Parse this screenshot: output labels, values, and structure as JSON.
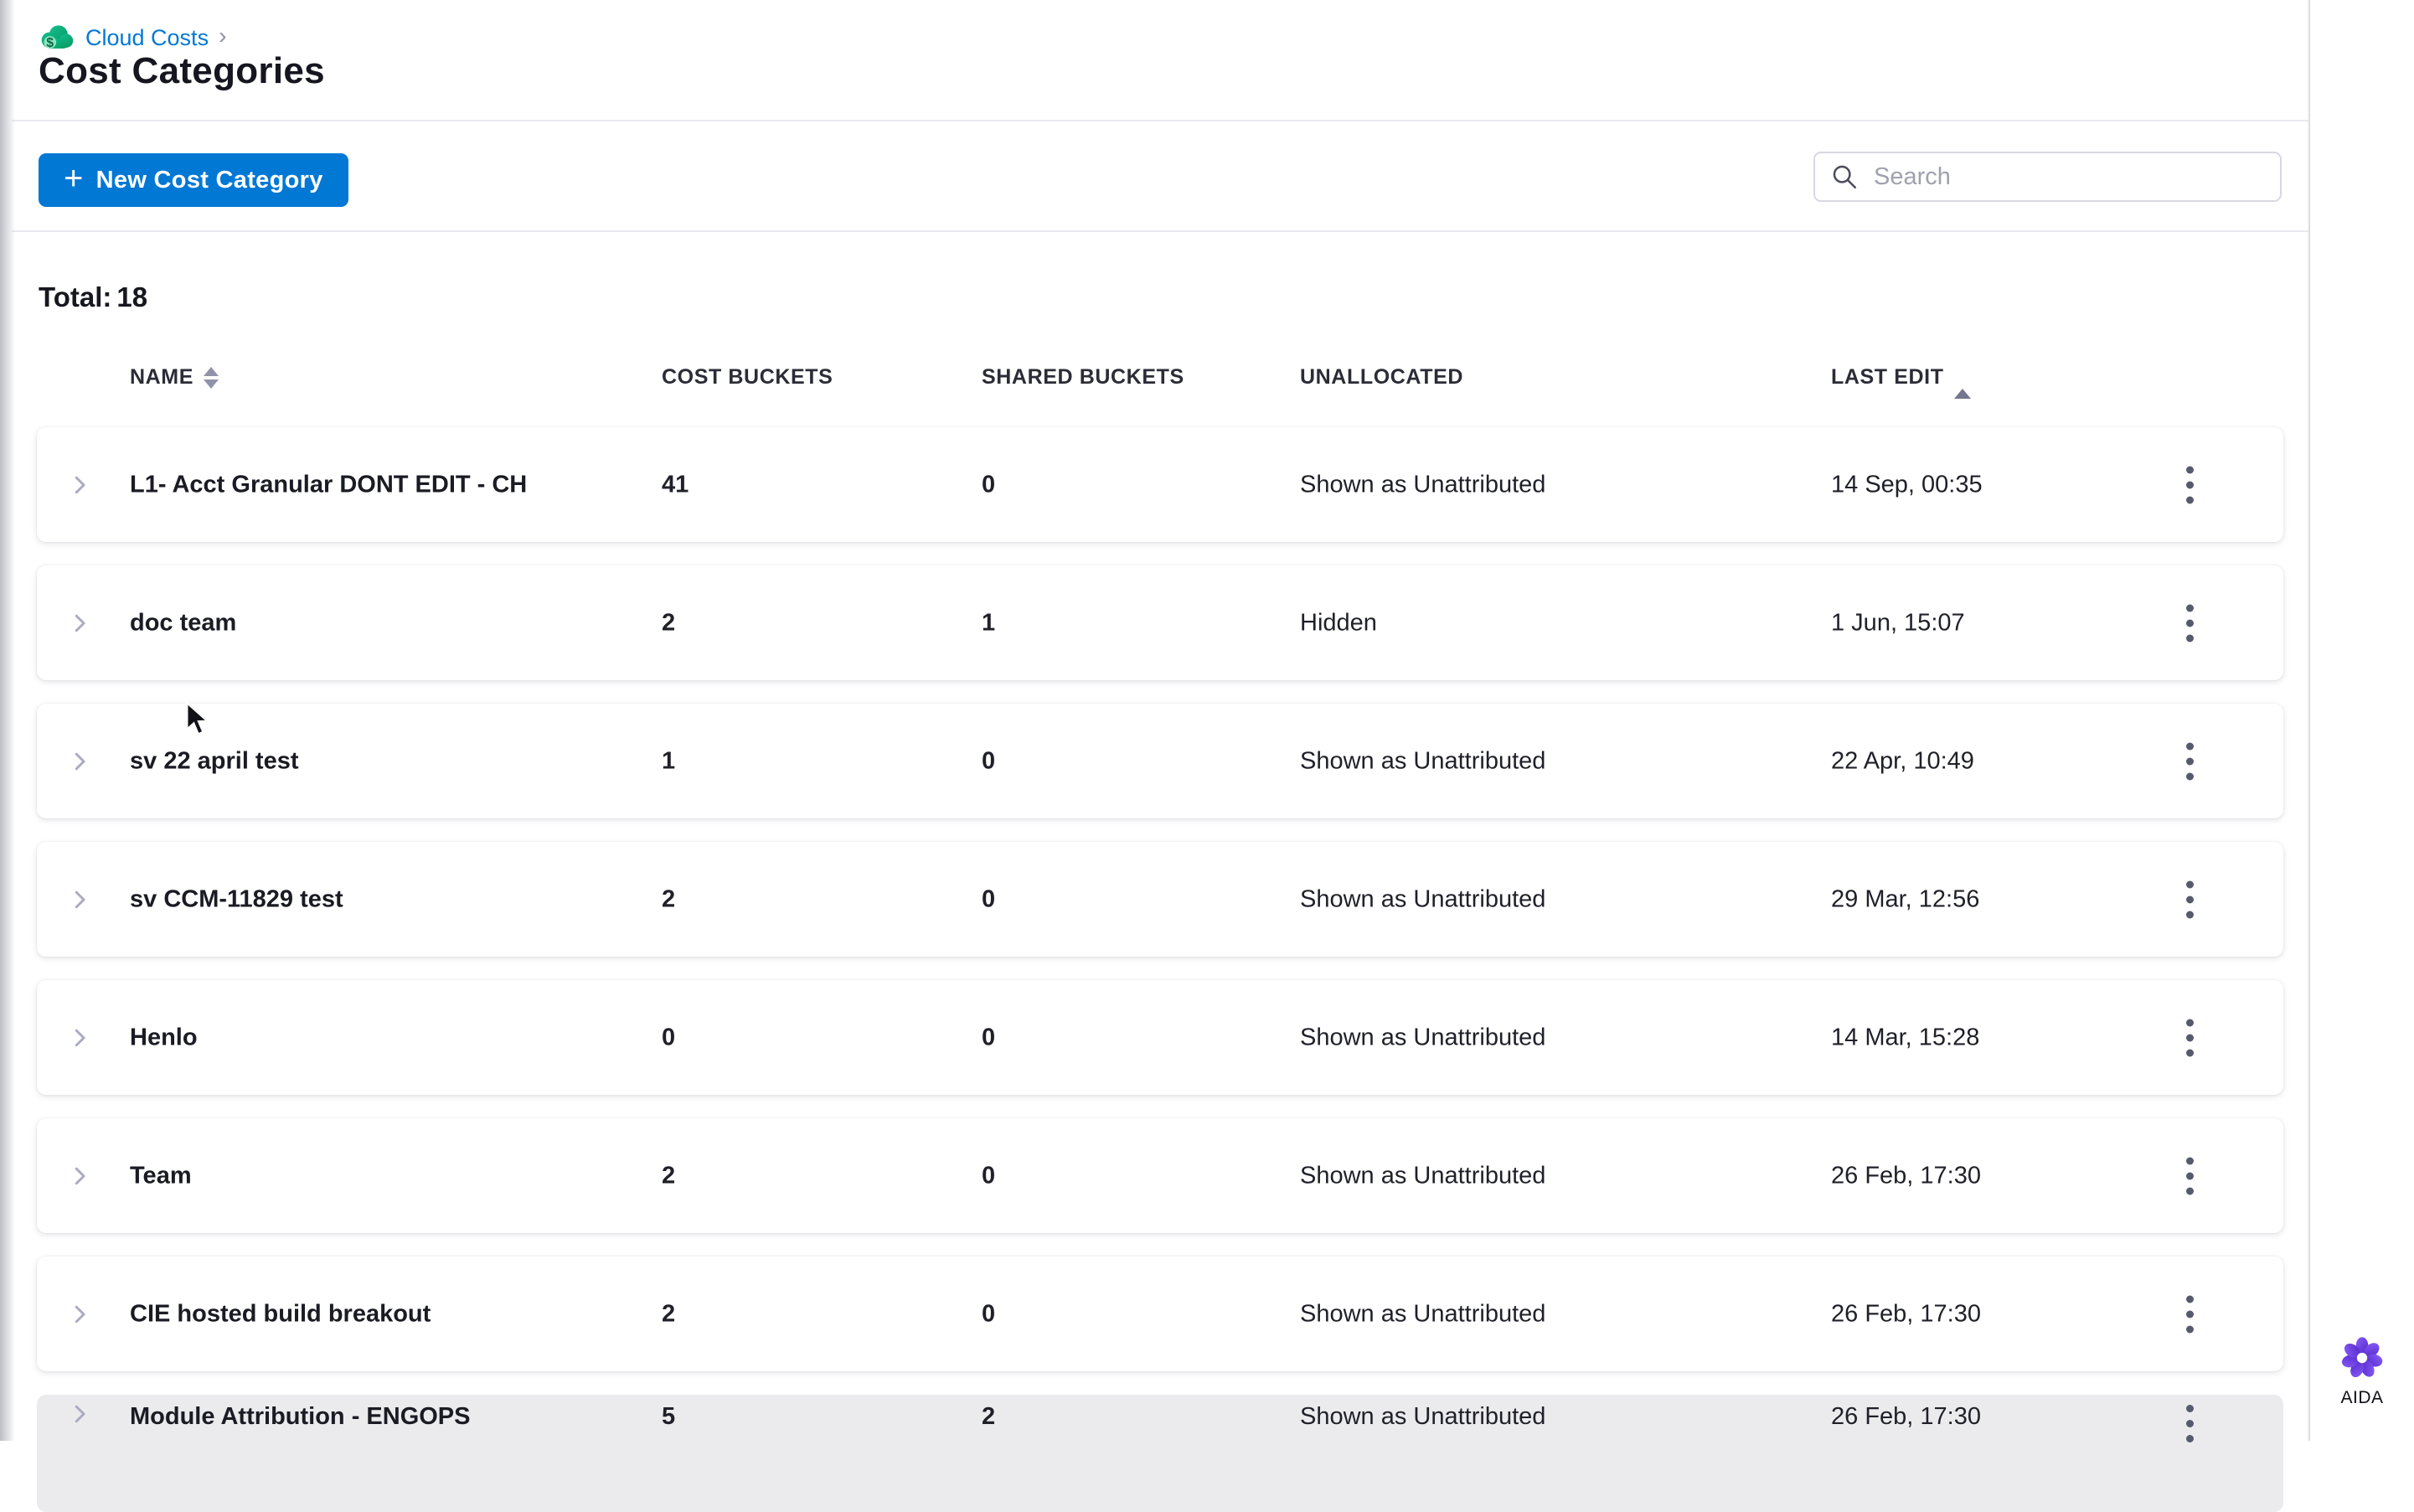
{
  "breadcrumb": {
    "section": "Cloud Costs",
    "separator": "›"
  },
  "page": {
    "title": "Cost Categories",
    "total_label": "Total:",
    "total_value": "18"
  },
  "toolbar": {
    "new_button_icon": "+",
    "new_button_label": "New Cost Category",
    "search_placeholder": "Search"
  },
  "table": {
    "columns": [
      {
        "label": "NAME",
        "sort": "both"
      },
      {
        "label": "COST BUCKETS",
        "sort": "none"
      },
      {
        "label": "SHARED BUCKETS",
        "sort": "none"
      },
      {
        "label": "UNALLOCATED",
        "sort": "none"
      },
      {
        "label": "LAST EDIT",
        "sort": "asc"
      }
    ],
    "rows": [
      {
        "name": "L1- Acct Granular DONT EDIT - CH",
        "cost_buckets": "41",
        "shared_buckets": "0",
        "unallocated": "Shown as Unattributed",
        "last_edit": "14 Sep, 00:35",
        "partial": false
      },
      {
        "name": "doc team",
        "cost_buckets": "2",
        "shared_buckets": "1",
        "unallocated": "Hidden",
        "last_edit": "1 Jun, 15:07",
        "partial": false
      },
      {
        "name": "sv 22 april test",
        "cost_buckets": "1",
        "shared_buckets": "0",
        "unallocated": "Shown as Unattributed",
        "last_edit": "22 Apr, 10:49",
        "partial": false
      },
      {
        "name": "sv CCM-11829 test",
        "cost_buckets": "2",
        "shared_buckets": "0",
        "unallocated": "Shown as Unattributed",
        "last_edit": "29 Mar, 12:56",
        "partial": false
      },
      {
        "name": "Henlo",
        "cost_buckets": "0",
        "shared_buckets": "0",
        "unallocated": "Shown as Unattributed",
        "last_edit": "14 Mar, 15:28",
        "partial": false
      },
      {
        "name": "Team",
        "cost_buckets": "2",
        "shared_buckets": "0",
        "unallocated": "Shown as Unattributed",
        "last_edit": "26 Feb, 17:30",
        "partial": false
      },
      {
        "name": "CIE hosted build breakout",
        "cost_buckets": "2",
        "shared_buckets": "0",
        "unallocated": "Shown as Unattributed",
        "last_edit": "26 Feb, 17:30",
        "partial": false
      },
      {
        "name": "Module Attribution - ENGOPS",
        "cost_buckets": "5",
        "shared_buckets": "2",
        "unallocated": "Shown as Unattributed",
        "last_edit": "26 Feb, 17:30",
        "partial": true
      }
    ]
  },
  "aida": {
    "label": "AIDA"
  },
  "colors": {
    "accent_blue": "#0278d5",
    "link_blue": "#0278d5",
    "cloud_green": "#0aa56c",
    "aida_purple": "#6d3bdb",
    "row_shadow": "#e6e7ee"
  }
}
